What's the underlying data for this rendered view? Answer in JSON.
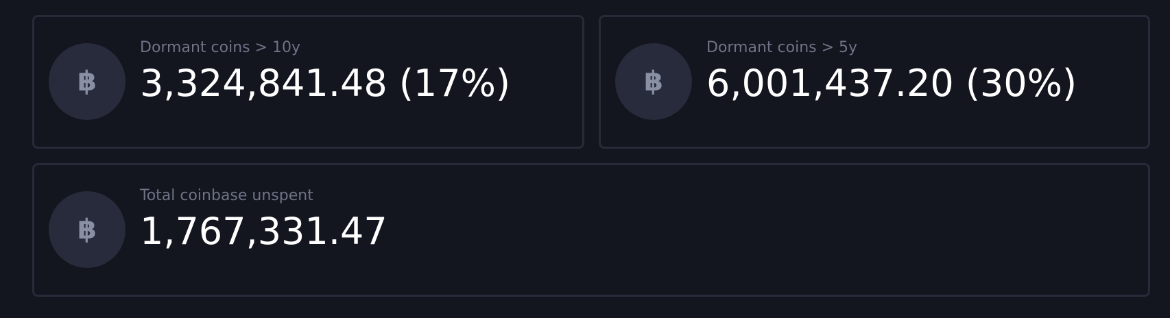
{
  "stats": [
    {
      "icon": "bitcoin-icon",
      "icon_glyph": "฿",
      "label": "Dormant coins > 10y",
      "value": "3,324,841.48 (17%)"
    },
    {
      "icon": "bitcoin-icon",
      "icon_glyph": "฿",
      "label": "Dormant coins > 5y",
      "value": "6,001,437.20 (30%)"
    },
    {
      "icon": "bitcoin-icon",
      "icon_glyph": "฿",
      "label": "Total coinbase unspent",
      "value": "1,767,331.47"
    }
  ],
  "colors": {
    "background": "#13151f",
    "card_border": "#272b39",
    "icon_circle": "#272b3b",
    "icon_glyph": "#8a90a3",
    "label_text": "#6e7486",
    "value_text": "#ffffff"
  }
}
